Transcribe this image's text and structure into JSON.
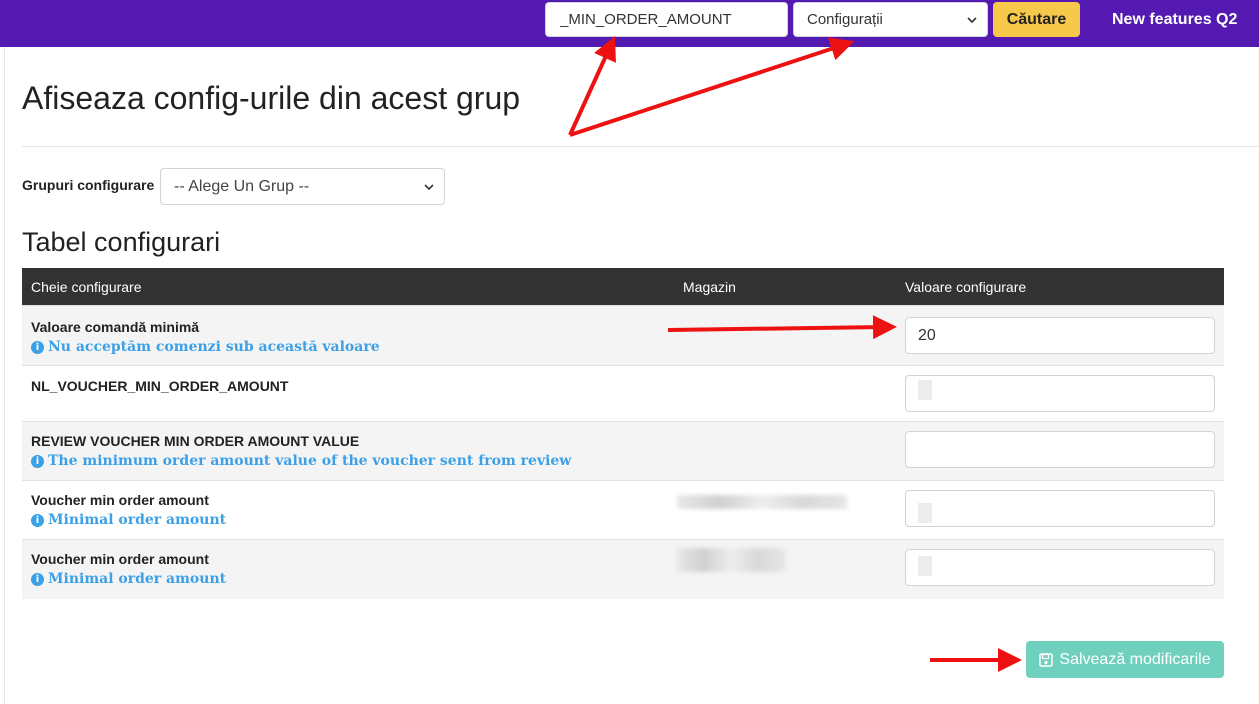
{
  "header": {
    "search_value": "_MIN_ORDER_AMOUNT",
    "section_select": "Configurații",
    "search_button": "Căutare",
    "nav_link": "New features Q2"
  },
  "page": {
    "title": "Afiseaza config-urile din acest grup",
    "group_label": "Grupuri configurare",
    "group_select": "-- Alege Un Grup --",
    "table_title": "Tabel configurari"
  },
  "table": {
    "columns": [
      "Cheie configurare",
      "Magazin",
      "Valoare configurare"
    ],
    "rows": [
      {
        "key": "Valoare comandă minimă",
        "hint": "Nu acceptăm comenzi sub această valoare",
        "value": "20"
      },
      {
        "key": "NL_VOUCHER_MIN_ORDER_AMOUNT",
        "hint": "",
        "value": ""
      },
      {
        "key": "REVIEW VOUCHER MIN ORDER AMOUNT VALUE",
        "hint": "The minimum order amount value of the voucher sent from review",
        "value": ""
      },
      {
        "key": "Voucher min order amount",
        "hint": "Minimal order amount",
        "value": ""
      },
      {
        "key": "Voucher min order amount",
        "hint": "Minimal order amount",
        "value": ""
      }
    ]
  },
  "actions": {
    "save_label": "Salvează modificarile"
  },
  "colors": {
    "topbar": "#5319b0",
    "search_button": "#f7c94a",
    "save_button": "#6fd0bd",
    "hint": "#3ba0e6",
    "annotation_arrow": "#ee1111"
  },
  "icons": [
    "chevron-down-icon",
    "info-icon",
    "save-icon",
    "annotation-arrow"
  ]
}
